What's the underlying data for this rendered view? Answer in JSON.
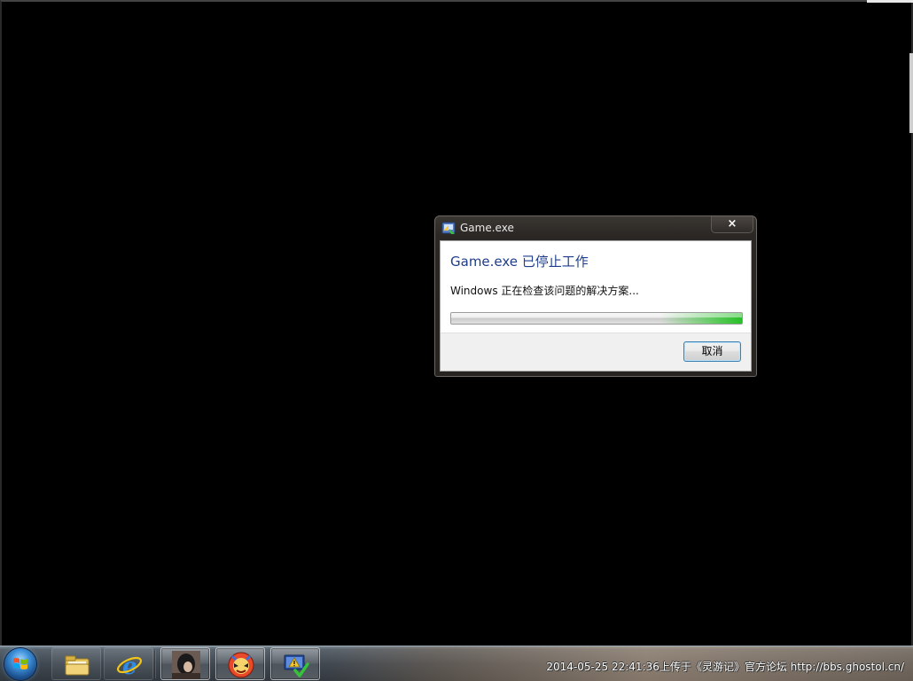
{
  "dialog": {
    "title": "Game.exe",
    "close_label": "×",
    "heading": "Game.exe 已停止工作",
    "message": "Windows 正在检查该问题的解决方案...",
    "cancel_label": "取消",
    "progress_state": "indeterminate"
  },
  "taskbar": {
    "start": {
      "icon": "windows-orb-icon"
    },
    "pinned": [
      {
        "name": "explorer",
        "icon": "folder-icon"
      },
      {
        "name": "internet-explorer",
        "icon": "ie-icon"
      }
    ],
    "running": [
      {
        "name": "avatar-window",
        "icon": "avatar-icon"
      },
      {
        "name": "game-window",
        "icon": "game-icon"
      },
      {
        "name": "error-report",
        "icon": "warning-shield-icon"
      }
    ],
    "watermark": "2014-05-25 22:41:36上传于《灵游记》官方论坛 http://bbs.ghostol.cn/"
  },
  "colors": {
    "heading": "#1e3d8a",
    "progress_green": "#22c022",
    "desktop": "#000000"
  }
}
